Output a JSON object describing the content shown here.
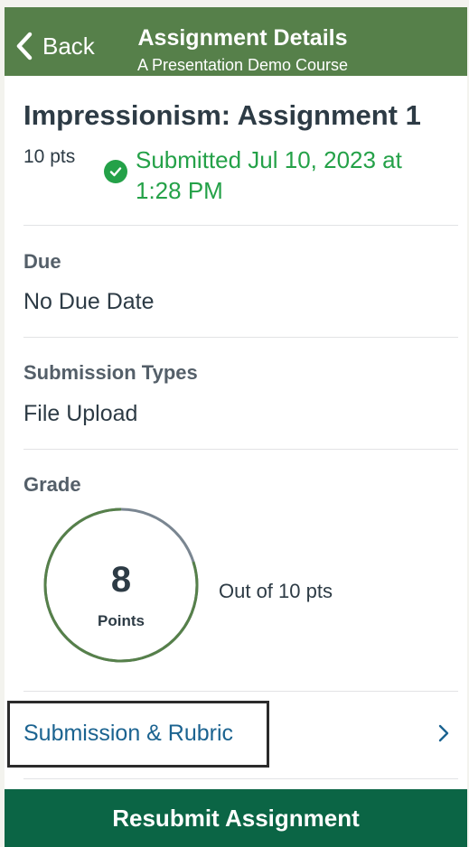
{
  "header": {
    "back_label": "Back",
    "title": "Assignment Details",
    "subtitle": "A Presentation Demo Course"
  },
  "assignment": {
    "title": "Impressionism: Assignment 1",
    "points": "10 pts",
    "submission_status": "Submitted Jul 10, 2023 at 1:28 PM"
  },
  "due": {
    "label": "Due",
    "value": "No Due Date"
  },
  "submission_types": {
    "label": "Submission Types",
    "value": "File Upload"
  },
  "grade": {
    "label": "Grade",
    "score": "8",
    "score_unit": "Points",
    "out_of": "Out of 10 pts",
    "fraction": 0.8
  },
  "rubric": {
    "label": "Submission & Rubric"
  },
  "footer": {
    "resubmit_label": "Resubmit Assignment"
  },
  "colors": {
    "header_bg": "#56804a",
    "success": "#24a148",
    "link": "#1b6390",
    "button_bg": "#0b6545",
    "ring_fill": "#56804a",
    "ring_track": "#7a8691"
  }
}
